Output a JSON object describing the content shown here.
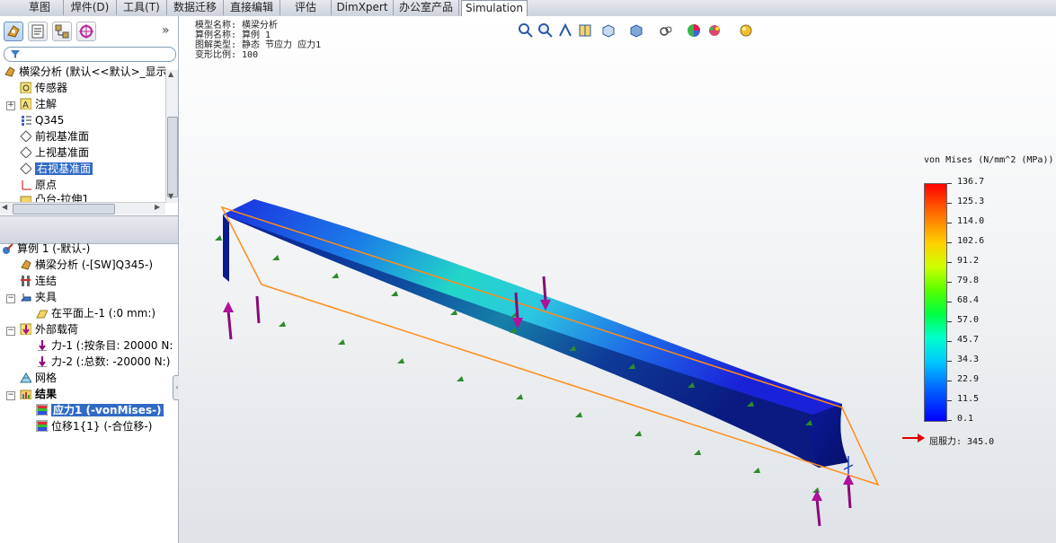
{
  "tabs": [
    "草图",
    "焊件(D)",
    "工具(T)",
    "数据迁移",
    "直接编辑",
    "评估",
    "DimXpert",
    "办公室产品",
    "Simulation"
  ],
  "active_tab": "Simulation",
  "feature_tree": {
    "root": "横梁分析  (默认<<默认>_显示",
    "items": [
      "传感器",
      "注解",
      "Q345",
      "前视基准面",
      "上视基准面",
      "右视基准面",
      "原点",
      "凸台-拉伸1"
    ]
  },
  "study_tree": {
    "root": "算例 1 (-默认-)",
    "items": [
      "横梁分析 (-[SW]Q345-)",
      "连结",
      "夹具",
      "在平面上-1 (:0 mm:)",
      "外部载荷",
      "力-1 (:按条目: 20000 N:",
      "力-2 (:总数: -20000 N:)",
      "网格",
      "结果",
      "应力1 (-vonMises-)",
      "位移1{1} (-合位移-)"
    ]
  },
  "plot_info": {
    "line1": "模型名称: 横梁分析",
    "line2": "算例名称: 算例 1",
    "line3": "图解类型: 静态 节应力 应力1",
    "line4": "变形比例: 100"
  },
  "legend": {
    "title": "von Mises (N/mm^2 (MPa))",
    "ticks": [
      "136.7",
      "125.3",
      "114.0",
      "102.6",
      "91.2",
      "79.8",
      "68.4",
      "57.0",
      "45.7",
      "34.3",
      "22.9",
      "11.5",
      "0.1"
    ],
    "yield_label": "屈服力: 345.0"
  },
  "icons": {
    "view_tools": [
      "zoom-to-fit-icon",
      "zoom-area-icon",
      "previous-view-icon",
      "section-view-icon",
      "view-orientation-icon",
      "display-style-icon",
      "hide-show-icon",
      "edit-appearance-icon",
      "apply-scene-icon",
      "view-settings-icon"
    ]
  },
  "colors": {
    "selection": "#316ac5",
    "yield_arrow": "#e00000",
    "plane_outline": "#ff8c1a"
  }
}
